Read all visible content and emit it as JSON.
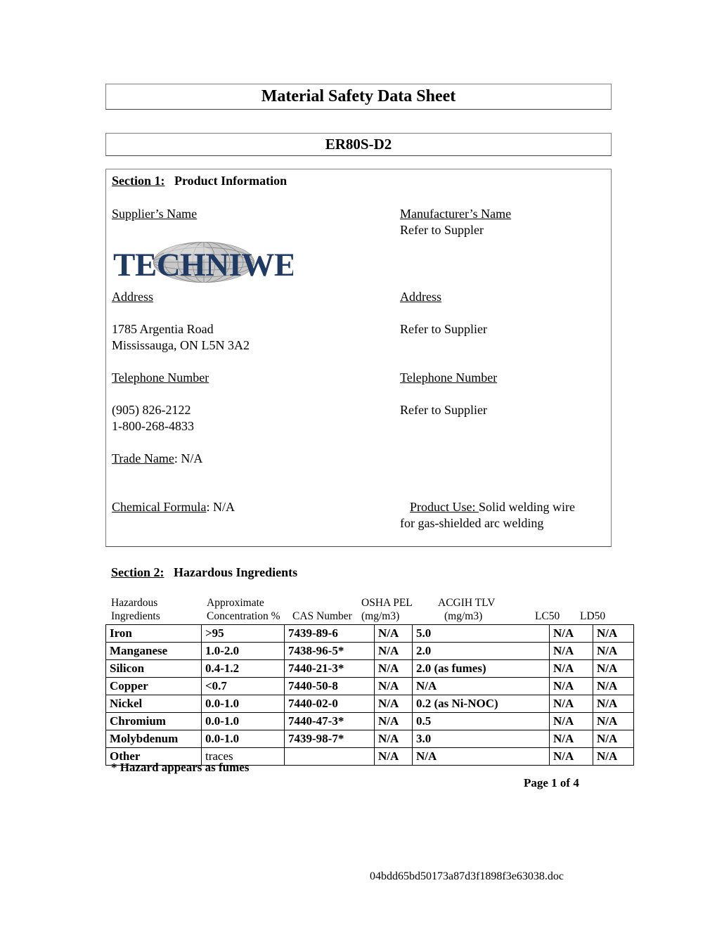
{
  "document": {
    "title": "Material Safety Data Sheet",
    "product_code": "ER80S-D2",
    "filename": "04bdd65bd50173a87d3f1898f3e63038.doc",
    "page_number": "Page 1 of  4"
  },
  "section1": {
    "number": "Section 1:",
    "title": "Product Information",
    "supplier": {
      "name_label": "Supplier’s Name",
      "logo_text": "TECHNIWELD",
      "address_label": "Address",
      "address_line1": "1785 Argentia Road",
      "address_line2": "Mississauga, ON L5N 3A2",
      "phone_label": "Telephone Number",
      "phone1": "(905) 826-2122",
      "phone2": "1-800-268-4833"
    },
    "manufacturer": {
      "name_label": "Manufacturer’s Name",
      "name_value": "Refer to Suppler",
      "address_label": "Address",
      "address_value": "Refer to Supplier",
      "phone_label": "Telephone Number",
      "phone_value": "Refer to Supplier"
    },
    "trade_name_label": "Trade Name",
    "trade_name_value": ": N/A",
    "chemical_formula_label": "Chemical Formula",
    "chemical_formula_value": ":  N/A",
    "product_use_label": "Product Use: ",
    "product_use_line1": " Solid welding wire",
    "product_use_line2": "for gas-shielded arc welding"
  },
  "section2": {
    "number": "Section 2:",
    "title": "Hazardous Ingredients",
    "table_headers": {
      "name_l1": "Hazardous",
      "name_l2": "Ingredients",
      "conc_l1": "Approximate",
      "conc_l2": "Concentration %",
      "cas_l1": "",
      "cas_l2": "CAS Number",
      "osha_l1": "OSHA PEL",
      "osha_l2": "(mg/m3)",
      "acgih_l1": "ACGIH TLV",
      "acgih_l2": "(mg/m3)",
      "lc50_l1": "",
      "lc50_l2": "LC50",
      "ld50_l1": "",
      "ld50_l2": "LD50"
    },
    "rows": [
      {
        "name": "Iron",
        "concentration": ">95",
        "cas": "7439-89-6",
        "osha": "N/A",
        "acgih": "5.0",
        "lc50": "N/A",
        "ld50": "N/A"
      },
      {
        "name": "Manganese",
        "concentration": "1.0-2.0",
        "cas": "7438-96-5*",
        "osha": "N/A",
        "acgih": "2.0",
        "lc50": "N/A",
        "ld50": "N/A"
      },
      {
        "name": "Silicon",
        "concentration": "0.4-1.2",
        "cas": "7440-21-3*",
        "osha": "N/A",
        "acgih": "2.0 (as fumes)",
        "lc50": "N/A",
        "ld50": "N/A"
      },
      {
        "name": "Copper",
        "concentration": "<0.7",
        "cas": "7440-50-8",
        "osha": "N/A",
        "acgih": "N/A",
        "lc50": "N/A",
        "ld50": "N/A"
      },
      {
        "name": "Nickel",
        "concentration": "0.0-1.0",
        "cas": "7440-02-0",
        "osha": "N/A",
        "acgih": "0.2 (as Ni-NOC)",
        "lc50": "N/A",
        "ld50": "N/A"
      },
      {
        "name": "Chromium",
        "concentration": "0.0-1.0",
        "cas": "7440-47-3*",
        "osha": "N/A",
        "acgih": "0.5",
        "lc50": "N/A",
        "ld50": "N/A"
      },
      {
        "name": "Molybdenum",
        "concentration": "0.0-1.0",
        "cas": "7439-98-7*",
        "osha": "N/A",
        "acgih": "3.0",
        "lc50": "N/A",
        "ld50": "N/A"
      },
      {
        "name": "Other",
        "concentration": "traces",
        "cas": "",
        "osha": "N/A",
        "acgih": "N/A",
        "lc50": "N/A",
        "ld50": "N/A"
      }
    ],
    "footnote": "* Hazard appears as fumes"
  },
  "colors": {
    "logo_navy": "#1f3a63",
    "logo_globe_gray": "#a9a9a9",
    "box_border": "#7f7f7f",
    "table_border": "#000000"
  }
}
